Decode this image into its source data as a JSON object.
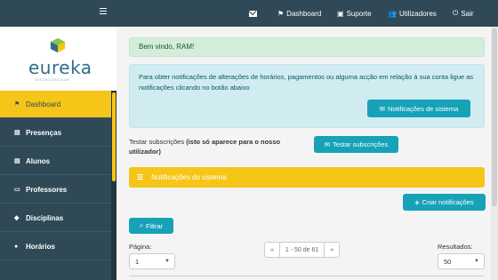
{
  "topbar": {
    "dashboard": "Dashboard",
    "suporte": "Suporte",
    "utilizadores": "Utilizadores",
    "sair": "Sair"
  },
  "logo": {
    "name": "eureka",
    "tagline": "GESTÃO ESCOLAR"
  },
  "sidebar": {
    "items": [
      {
        "label": "Dashboard",
        "icon": "flag-icon"
      },
      {
        "label": "Presenças",
        "icon": "user-card-icon"
      },
      {
        "label": "Alunos",
        "icon": "user-card-icon"
      },
      {
        "label": "Professores",
        "icon": "chalkboard-teacher-icon"
      },
      {
        "label": "Disciplinas",
        "icon": "graduation-cap-icon"
      },
      {
        "label": "Horários",
        "icon": "clock-icon"
      }
    ]
  },
  "main": {
    "welcome": "Bem vindo, RAM!",
    "info_text": "Para obter notificações de alterações de horários, pagamentos ou alguma acção em relação à sua conta ligue as notificações clicando no botão abaixo",
    "notif_button": "Notificações de sistema",
    "test_prefix": "Testar subscrições ",
    "test_bold": "(isto só aparece para o nosso utilizador)",
    "test_button": "Testar subscrições",
    "section_title": "Notificações do sistema",
    "create_button": "Criar notificações",
    "filter_button": "Filtrar",
    "page_label": "Página:",
    "page_value": "1",
    "pagination": {
      "prev": "«",
      "range": "1 - 50 de 61",
      "next": "»"
    },
    "results_label": "Resultados:",
    "results_value": "50"
  },
  "colors": {
    "navy": "#2f4a56",
    "yellow": "#f5c518",
    "teal": "#17a2b8"
  }
}
